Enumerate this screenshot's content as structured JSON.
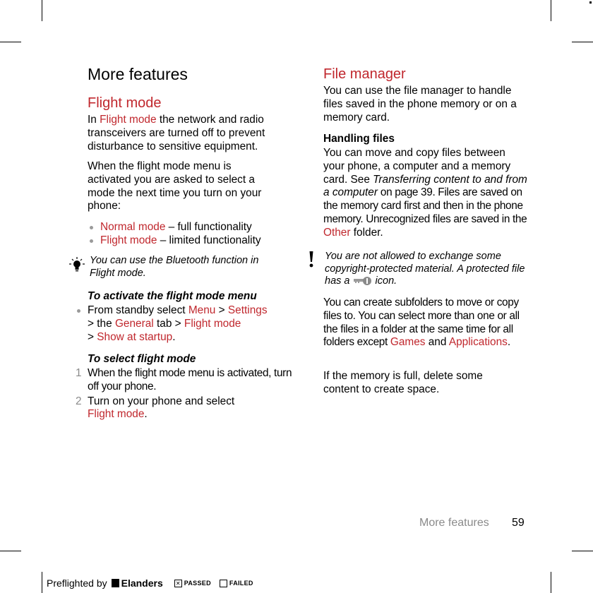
{
  "page": {
    "title": "More features",
    "footer": {
      "section": "More features",
      "page_number": "59"
    }
  },
  "left": {
    "flight_mode": {
      "heading": "Flight mode",
      "intro": {
        "pre": "In ",
        "link": "Flight mode",
        "post": " the network and radio transceivers are turned off to prevent disturbance to sensitive equipment."
      },
      "para2": "When the flight mode menu is activated you are asked to select a mode the next time you turn on your phone:",
      "modes": [
        {
          "name": "Normal mode",
          "desc": " – full functionality"
        },
        {
          "name": "Flight mode",
          "desc": " – limited functionality"
        }
      ],
      "tip": {
        "icon": "lightbulb-icon",
        "text": "You can use the Bluetooth function in Flight mode."
      },
      "activate": {
        "heading": "To activate the flight mode menu",
        "step": {
          "pre": "From standby select ",
          "menu": "Menu",
          "sep1": " > ",
          "settings": "Settings",
          "sep2": " > the ",
          "general": "General",
          "sep3": " tab > ",
          "flight": "Flight mode",
          "sep4": " > ",
          "show": "Show at startup",
          "end": "."
        }
      },
      "select": {
        "heading": "To select flight mode",
        "steps": [
          {
            "num": "1",
            "text": "When the flight mode menu is activated, turn off your phone."
          },
          {
            "num": "2",
            "text": "Turn on your phone and select ",
            "link": "Flight mode",
            "end": "."
          }
        ]
      }
    }
  },
  "right": {
    "file_manager": {
      "heading": "File manager",
      "intro": "You can use the file manager to handle files saved in the phone memory or on a memory card.",
      "handling": {
        "heading": "Handling files",
        "p1": "You can move and copy files between your phone, a computer and a memory card. See ",
        "ref": "Transferring content to and from a computer",
        "p2": " on page 39. Files are saved on the memory card first and then in the phone memory. Unrecognized files are saved in the ",
        "folder": "Other",
        "p3": " folder."
      },
      "warning": {
        "icon": "exclamation-icon",
        "pre": "You are not allowed to exchange some copyright-protected material. A protected file has a ",
        "key_icon": "key-icon",
        "post": " icon."
      },
      "subfolders": {
        "pre": "You can create subfolders to move or copy files to. You can select more than one or all the files in a folder at the same time for all folders except ",
        "games": "Games",
        "and": " and ",
        "apps": "Applications",
        "end": "."
      },
      "full": "If the memory is full, delete some content to create space."
    }
  },
  "preflight": {
    "label": "Preflighted by",
    "brand": "Elanders",
    "passed": "PASSED",
    "failed": "FAILED",
    "passed_mark": "✕"
  },
  "colors": {
    "accent": "#c0272d",
    "muted": "#8a8a8a"
  }
}
